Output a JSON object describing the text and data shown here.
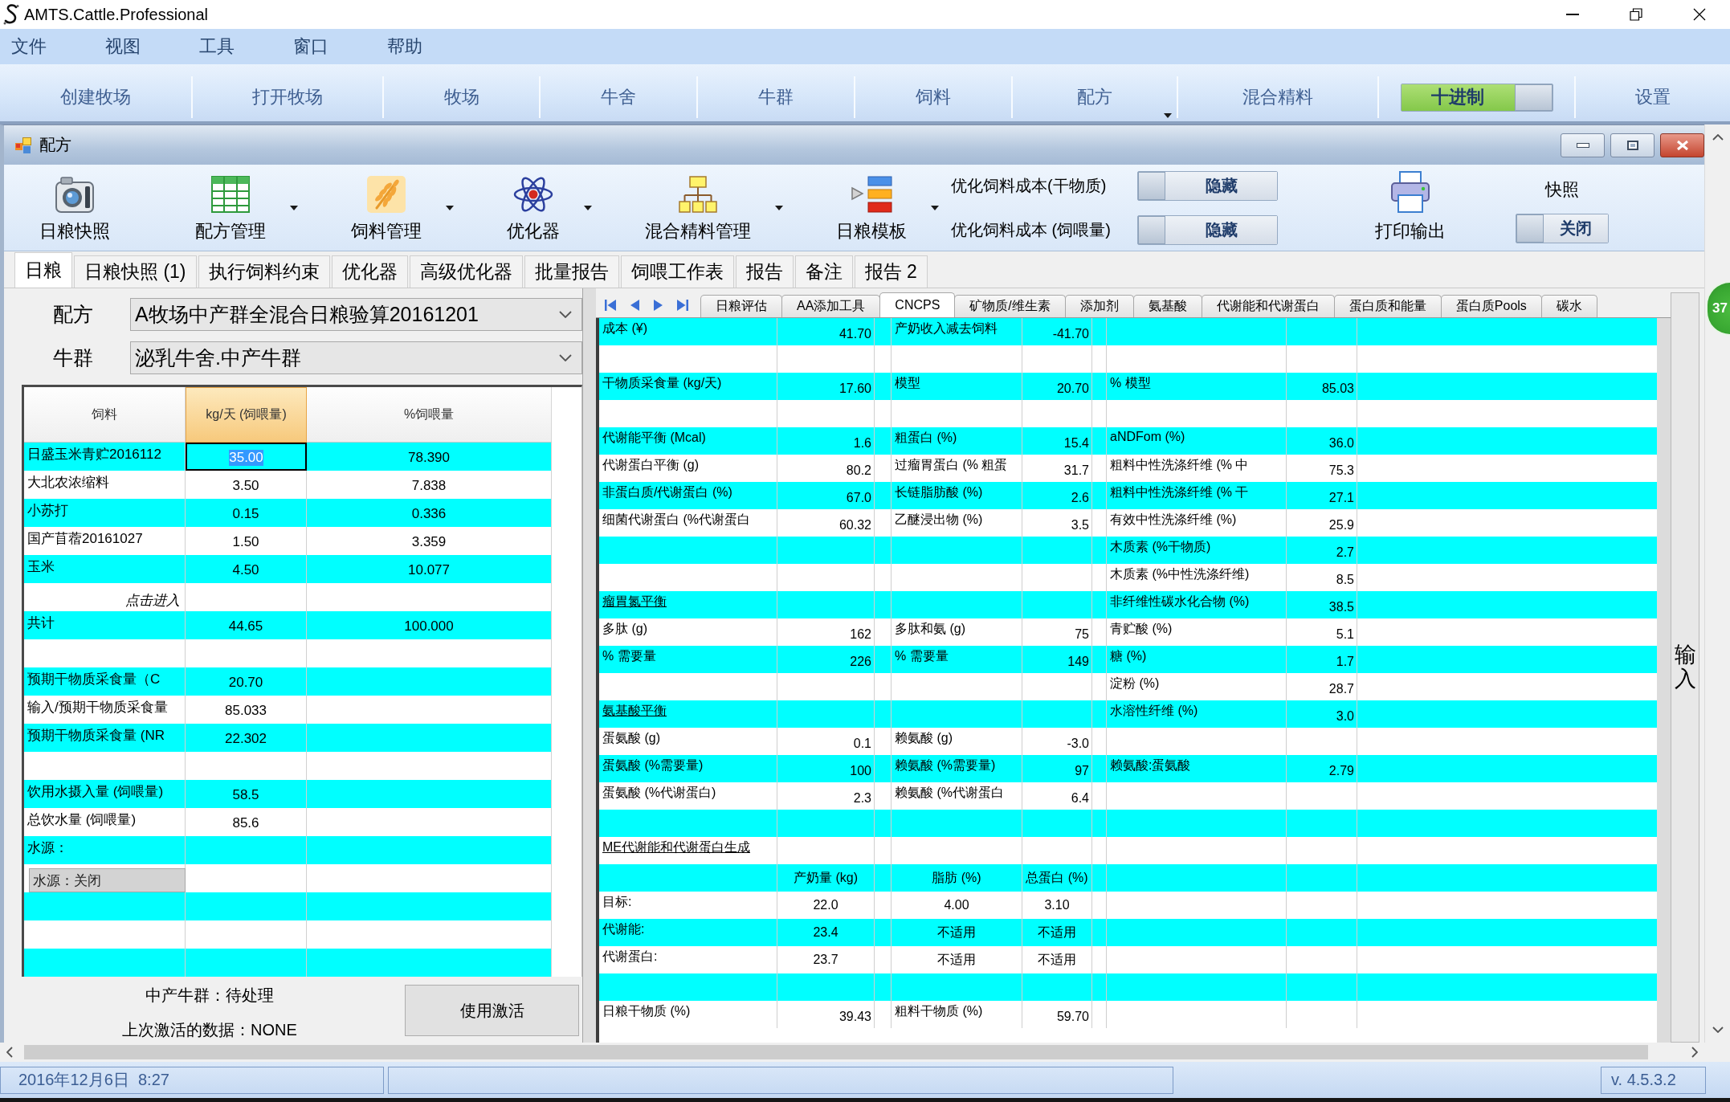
{
  "window": {
    "title": "AMTS.Cattle.Professional"
  },
  "menu_bar": [
    "文件",
    "视图",
    "工具",
    "窗口",
    "帮助"
  ],
  "nav_bar": [
    {
      "kind": "button",
      "label": "创建牧场"
    },
    {
      "kind": "button",
      "label": "打开牧场"
    },
    {
      "kind": "button",
      "label": "牧场"
    },
    {
      "kind": "button",
      "label": "牛舍"
    },
    {
      "kind": "button",
      "label": "牛群"
    },
    {
      "kind": "button",
      "label": "饲料"
    },
    {
      "kind": "dropdown",
      "label": "配方"
    },
    {
      "kind": "button",
      "label": "混合精料"
    },
    {
      "kind": "toggle",
      "label": "十进制",
      "on": true
    },
    {
      "kind": "button",
      "label": "设置"
    }
  ],
  "child_window": {
    "title": "配方",
    "toolbar": {
      "buttons": [
        {
          "label": "日粮快照",
          "dropdown": false
        },
        {
          "label": "配方管理",
          "dropdown": true
        },
        {
          "label": "饲料管理",
          "dropdown": true
        },
        {
          "label": "优化器",
          "dropdown": true
        },
        {
          "label": "混合精料管理",
          "dropdown": true
        },
        {
          "label": "日粮模板",
          "dropdown": true
        }
      ],
      "cost_toggles": [
        {
          "label": "优化饲料成本(干物质)",
          "state": "隐藏",
          "on": false
        },
        {
          "label": "优化饲料成本 (饲喂量)",
          "state": "隐藏",
          "on": false
        }
      ],
      "print_button": {
        "label": "打印输出"
      },
      "snapshot": {
        "label": "快照",
        "state": "关闭",
        "on": false
      }
    },
    "tabs": [
      {
        "label": "日粮",
        "selected": true
      },
      {
        "label": "日粮快照 (1)",
        "selected": false
      },
      {
        "label": "执行饲料约束",
        "selected": false
      },
      {
        "label": "优化器",
        "selected": false
      },
      {
        "label": "高级优化器",
        "selected": false
      },
      {
        "label": "批量报告",
        "selected": false
      },
      {
        "label": "饲喂工作表",
        "selected": false
      },
      {
        "label": "报告",
        "selected": false
      },
      {
        "label": "备注",
        "selected": false
      },
      {
        "label": "报告 2",
        "selected": false
      }
    ],
    "left_panel": {
      "fields": [
        {
          "label": "配方",
          "value": "A牧场中产群全混合日粮验算20161201"
        },
        {
          "label": "牛群",
          "value": "泌乳牛舍.中产牛群"
        }
      ],
      "grid": {
        "columns": [
          {
            "label": "饲料",
            "selected": false
          },
          {
            "label": "kg/天 (饲喂量)",
            "selected": true
          },
          {
            "label": "%饲喂量",
            "selected": false
          }
        ],
        "rows": [
          {
            "kind": "data",
            "cells": [
              "日盛玉米青贮2016112",
              "35.00",
              "78.390"
            ],
            "selected": true
          },
          {
            "kind": "data",
            "cells": [
              "大北农浓缩料",
              "3.50",
              "7.838"
            ],
            "selected": false
          },
          {
            "kind": "data",
            "cells": [
              "小苏打",
              "0.15",
              "0.336"
            ],
            "selected": false
          },
          {
            "kind": "data",
            "cells": [
              "国产苜蓿20161027",
              "1.50",
              "3.359"
            ],
            "selected": false
          },
          {
            "kind": "data",
            "cells": [
              "玉米",
              "4.50",
              "10.077"
            ],
            "selected": false
          },
          {
            "kind": "hint",
            "cells": [
              "点击进入"
            ],
            "selected": false
          },
          {
            "kind": "data",
            "cells": [
              "共计",
              "44.65",
              "100.000"
            ],
            "selected": false
          },
          {
            "kind": "blank",
            "selected": false
          },
          {
            "kind": "data",
            "cells": [
              "预期干物质采食量（C",
              "20.70"
            ],
            "selected": false
          },
          {
            "kind": "data",
            "cells": [
              "输入/预期干物质采食量",
              "85.033"
            ],
            "selected": false
          },
          {
            "kind": "data",
            "cells": [
              "预期干物质采食量 (NR",
              "22.302"
            ],
            "selected": false
          },
          {
            "kind": "blank",
            "selected": false
          },
          {
            "kind": "data",
            "cells": [
              "饮用水摄入量 (饲喂量)",
              "58.5"
            ],
            "selected": false
          },
          {
            "kind": "data",
            "cells": [
              "总饮水量 (饲喂量)",
              "85.6"
            ],
            "selected": false
          },
          {
            "kind": "data",
            "cells": [
              "水源："
            ],
            "selected": false
          },
          {
            "kind": "button",
            "cells": [
              "水源：关闭"
            ],
            "selected": false
          },
          {
            "kind": "blank",
            "selected": false
          },
          {
            "kind": "blank",
            "selected": false
          },
          {
            "kind": "blank",
            "selected": false
          }
        ]
      },
      "footer": {
        "status": "中产牛群：待处理",
        "last_activation": "上次激活的数据：NONE",
        "button": "使用激活"
      }
    },
    "right_panel": {
      "tabs": [
        {
          "label": "日粮评估",
          "selected": false
        },
        {
          "label": "AA添加工具",
          "selected": false
        },
        {
          "label": "CNCPS",
          "selected": true
        },
        {
          "label": "矿物质/维生素",
          "selected": false
        },
        {
          "label": "添加剂",
          "selected": false
        },
        {
          "label": "氨基酸",
          "selected": false
        },
        {
          "label": "代谢能和代谢蛋白",
          "selected": false
        },
        {
          "label": "蛋白质和能量",
          "selected": false
        },
        {
          "label": "蛋白质Pools",
          "selected": false
        },
        {
          "label": "碳水",
          "selected": false
        }
      ],
      "grid": {
        "rows": [
          {
            "kind": "data",
            "column_1": "成本 (¥)",
            "column_2": "41.70",
            "column_3": "产奶收入减去饲料",
            "column_4": "-41.70"
          },
          {
            "kind": "blank"
          },
          {
            "kind": "data",
            "column_1": "干物质采食量 (kg/天)",
            "column_2": "17.60",
            "column_3": "模型",
            "column_4": "20.70",
            "column_5": "% 模型",
            "column_6": "85.03"
          },
          {
            "kind": "blank"
          },
          {
            "kind": "data",
            "column_1": "代谢能平衡 (Mcal)",
            "column_2": "1.6",
            "column_3": "粗蛋白 (%)",
            "column_4": "15.4",
            "column_5": "aNDFom (%)",
            "column_6": "36.0"
          },
          {
            "kind": "data",
            "column_1": "代谢蛋白平衡 (g)",
            "column_2": "80.2",
            "column_3": "过瘤胃蛋白 (% 粗蛋",
            "column_4": "31.7",
            "column_5": "粗料中性洗涤纤维 (% 中",
            "column_6": "75.3"
          },
          {
            "kind": "data",
            "column_1": "非蛋白质/代谢蛋白 (%)",
            "column_2": "67.0",
            "column_3": "长链脂肪酸 (%)",
            "column_4": "2.6",
            "column_5": "粗料中性洗涤纤维 (% 干",
            "column_6": "27.1"
          },
          {
            "kind": "data",
            "column_1": "细菌代谢蛋白 (%代谢蛋白",
            "column_2": "60.32",
            "column_3": "乙醚浸出物 (%)",
            "column_4": "3.5",
            "column_5": "有效中性洗涤纤维 (%)",
            "column_6": "25.9"
          },
          {
            "kind": "data",
            "column_5": "木质素 (%干物质)",
            "column_6": "2.7"
          },
          {
            "kind": "data",
            "column_5": "木质素 (%中性洗涤纤维)",
            "column_6": "8.5"
          },
          {
            "kind": "section",
            "column_1": "瘤胃氮平衡",
            "column_5": "非纤维性碳水化合物 (%)",
            "column_6": "38.5"
          },
          {
            "kind": "data",
            "column_1": "多肽 (g)",
            "column_2": "162",
            "column_3": "多肽和氨 (g)",
            "column_4": "75",
            "column_5": "青贮酸 (%)",
            "column_6": "5.1"
          },
          {
            "kind": "data",
            "column_1": "% 需要量",
            "column_2": "226",
            "column_3": "% 需要量",
            "column_4": "149",
            "column_5": "糖 (%)",
            "column_6": "1.7"
          },
          {
            "kind": "data",
            "column_5": "淀粉 (%)",
            "column_6": "28.7"
          },
          {
            "kind": "section",
            "column_1": "氨基酸平衡",
            "column_5": "水溶性纤维 (%)",
            "column_6": "3.0"
          },
          {
            "kind": "data",
            "column_1": "蛋氨酸 (g)",
            "column_2": "0.1",
            "column_3": "赖氨酸 (g)",
            "column_4": "-3.0"
          },
          {
            "kind": "data",
            "column_1": "蛋氨酸 (%需要量)",
            "column_2": "100",
            "column_3": "赖氨酸 (%需要量)",
            "column_4": "97",
            "column_5": "赖氨酸:蛋氨酸",
            "column_6": "2.79"
          },
          {
            "kind": "data",
            "column_1": "蛋氨酸 (%代谢蛋白)",
            "column_2": "2.3",
            "column_3": "赖氨酸 (%代谢蛋白",
            "column_4": "6.4"
          },
          {
            "kind": "blank"
          },
          {
            "kind": "section",
            "column_1": "ME代谢能和代谢蛋白生成"
          },
          {
            "kind": "matrix",
            "column_2": "产奶量 (kg)",
            "column_3": "脂肪 (%)",
            "column_4": "总蛋白 (%)"
          },
          {
            "kind": "matrix",
            "column_1": "目标:",
            "column_2": "22.0",
            "column_3": "4.00",
            "column_4": "3.10"
          },
          {
            "kind": "matrix",
            "column_1": "代谢能:",
            "column_2": "23.4",
            "column_3": "不适用",
            "column_4": "不适用"
          },
          {
            "kind": "matrix",
            "column_1": "代谢蛋白:",
            "column_2": "23.7",
            "column_3": "不适用",
            "column_4": "不适用"
          },
          {
            "kind": "blank"
          },
          {
            "kind": "data",
            "column_1": "日粮干物质 (%)",
            "column_2": "39.43",
            "column_3": "粗料干物质 (%)",
            "column_4": "59.70"
          }
        ]
      },
      "side_tab": "输入"
    }
  },
  "floating_badge": "37",
  "status_bar": {
    "date_time": "2016年12月6日  8:27",
    "version": "v. 4.5.3.2"
  }
}
